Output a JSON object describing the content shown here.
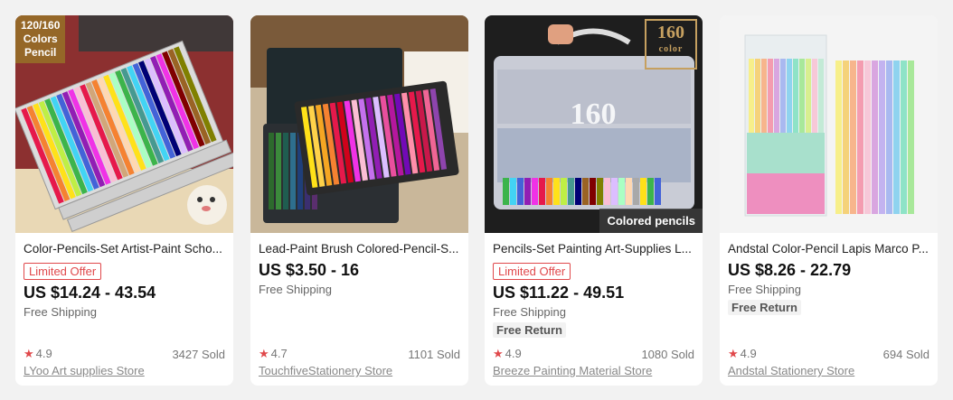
{
  "products": [
    {
      "title": "Color-Pencils-Set Artist-Paint Scho...",
      "badge": "Limited Offer",
      "price": "US $14.24 - 43.54",
      "shipping": "Free Shipping",
      "rating": "4.9",
      "sold": "3427 Sold",
      "store": "LYoo Art supplies Store",
      "image_text": "120/160\nColors\nPencil"
    },
    {
      "title": "Lead-Paint Brush Colored-Pencil-S...",
      "price": "US $3.50 - 16",
      "shipping": "Free Shipping",
      "rating": "4.7",
      "sold": "1101 Sold",
      "store": "TouchfiveStationery Store"
    },
    {
      "title": "Pencils-Set Painting Art-Supplies L...",
      "badge": "Limited Offer",
      "price": "US $11.22 - 49.51",
      "shipping": "Free Shipping",
      "return": "Free Return",
      "rating": "4.9",
      "sold": "1080 Sold",
      "store": "Breeze Painting Material Store",
      "image_label": "Colored pencils",
      "image_badge_number": "160",
      "image_badge_word": "color"
    },
    {
      "title": "Andstal Color-Pencil Lapis Marco P...",
      "price": "US $8.26 - 22.79",
      "shipping": "Free Shipping",
      "return": "Free Return",
      "rating": "4.9",
      "sold": "694 Sold",
      "store": "Andstal Stationery Store"
    }
  ],
  "colors": {
    "accent": "#e0484b",
    "background": "#f2f2f2",
    "card": "#ffffff"
  }
}
